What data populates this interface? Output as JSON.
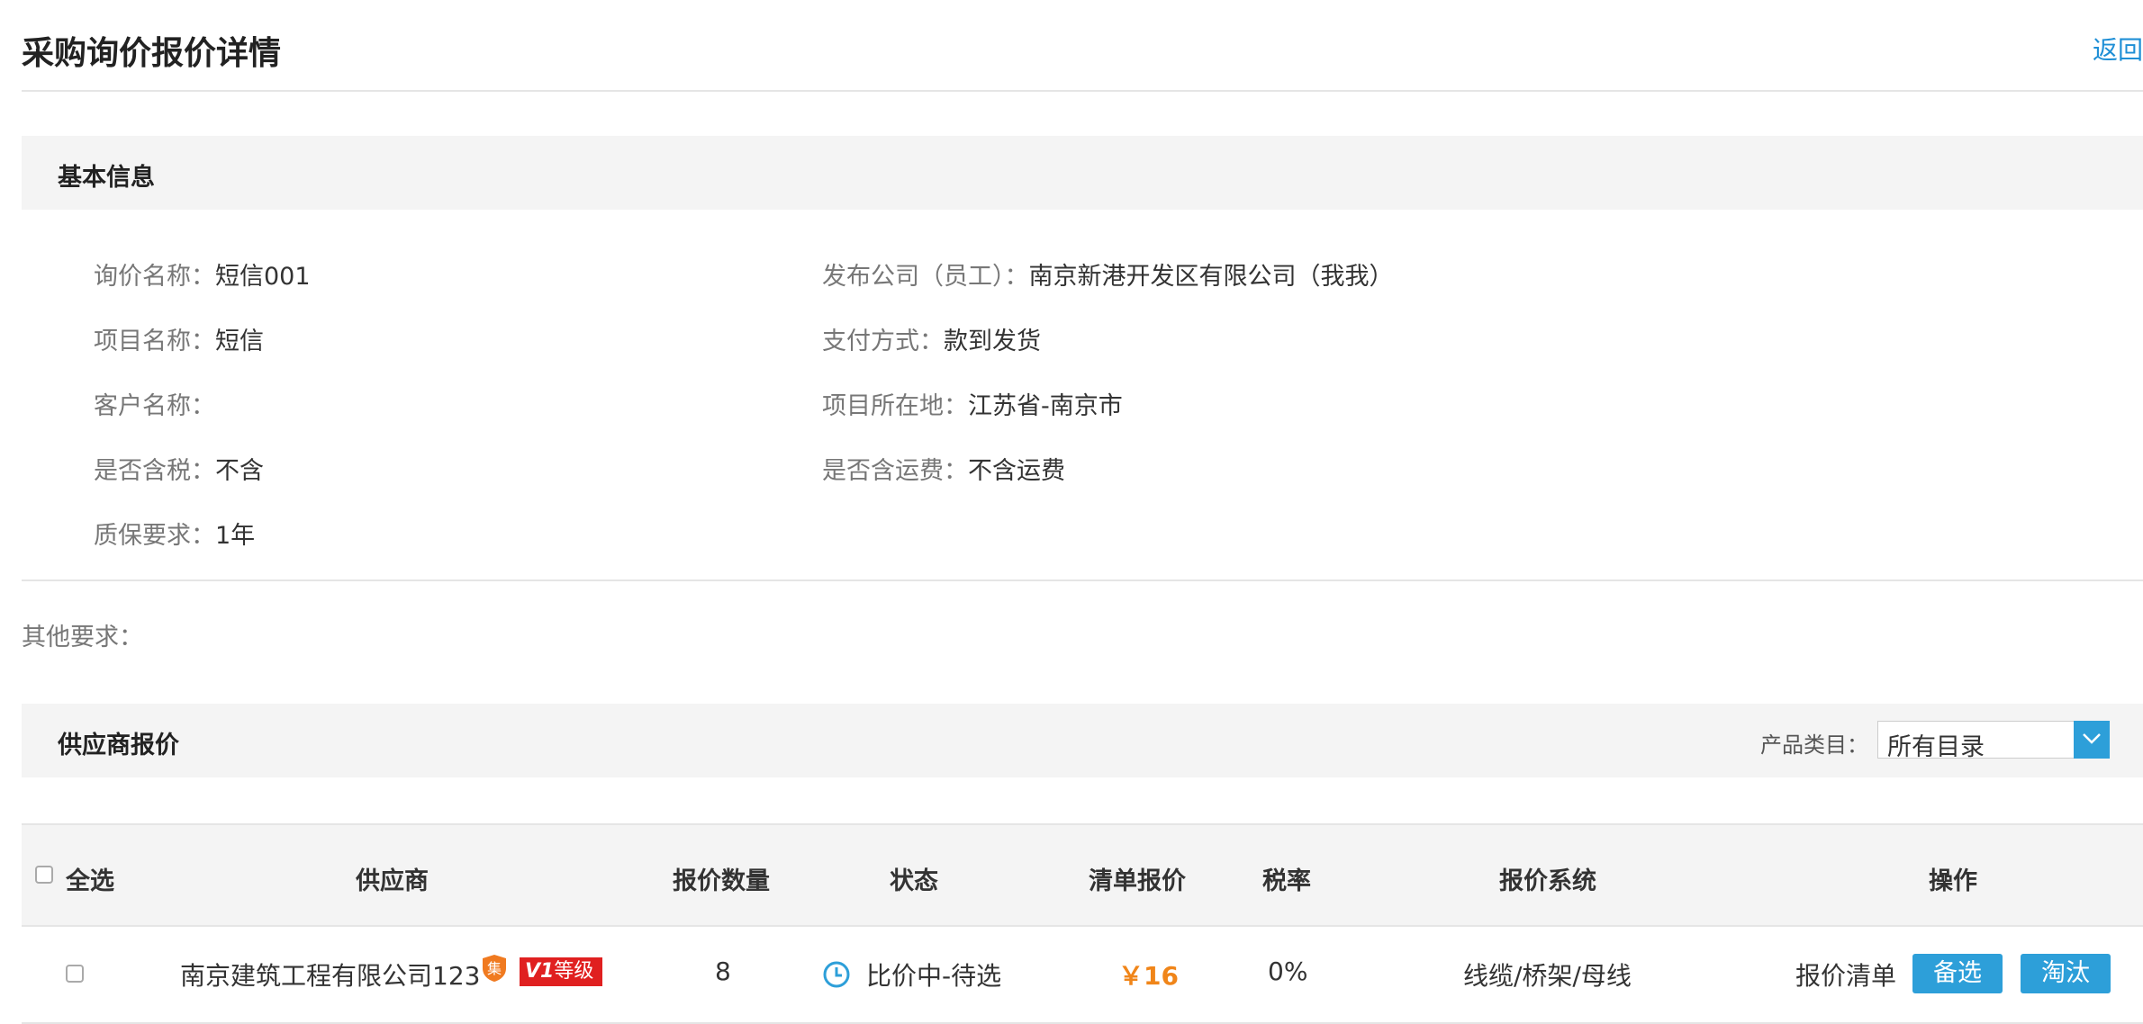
{
  "header": {
    "title": "采购询价报价详情",
    "back_label": "返回"
  },
  "basic_info": {
    "section_title": "基本信息",
    "left": [
      {
        "label": "询价名称：",
        "value": "短信001"
      },
      {
        "label": "项目名称：",
        "value": "短信"
      },
      {
        "label": "客户名称：",
        "value": ""
      },
      {
        "label": "是否含税：",
        "value": "不含"
      },
      {
        "label": "质保要求：",
        "value": "1年"
      }
    ],
    "right": [
      {
        "label": "发布公司（员工）：",
        "value": "南京新港开发区有限公司（我我）"
      },
      {
        "label": "支付方式：",
        "value": "款到发货"
      },
      {
        "label": "项目所在地：",
        "value": "江苏省-南京市"
      },
      {
        "label": "是否含运费：",
        "value": "不含运费"
      }
    ]
  },
  "other_requirements": {
    "label": "其他要求："
  },
  "supplier_quotes": {
    "section_title": "供应商报价",
    "filter_label": "产品类目：",
    "filter_value": "所有目录",
    "columns": [
      "全选",
      "供应商",
      "报价数量",
      "状态",
      "清单报价",
      "税率",
      "报价系统",
      "操作"
    ],
    "rows": [
      {
        "supplier": "南京建筑工程有限公司123",
        "badge_ji": "集",
        "badge_level": "等级",
        "quote_count": "8",
        "status": "比价中-待选",
        "list_price": "￥16",
        "tax_rate": "0%",
        "quote_system": "线缆/桥架/母线",
        "actions": {
          "list_link": "报价清单",
          "shortlist": "备选",
          "eliminate": "淘汰"
        }
      }
    ]
  },
  "colors": {
    "accent": "#2d9fd9",
    "price": "#f08519",
    "badge_red": "#e02020",
    "section_bg": "#f4f4f4"
  }
}
